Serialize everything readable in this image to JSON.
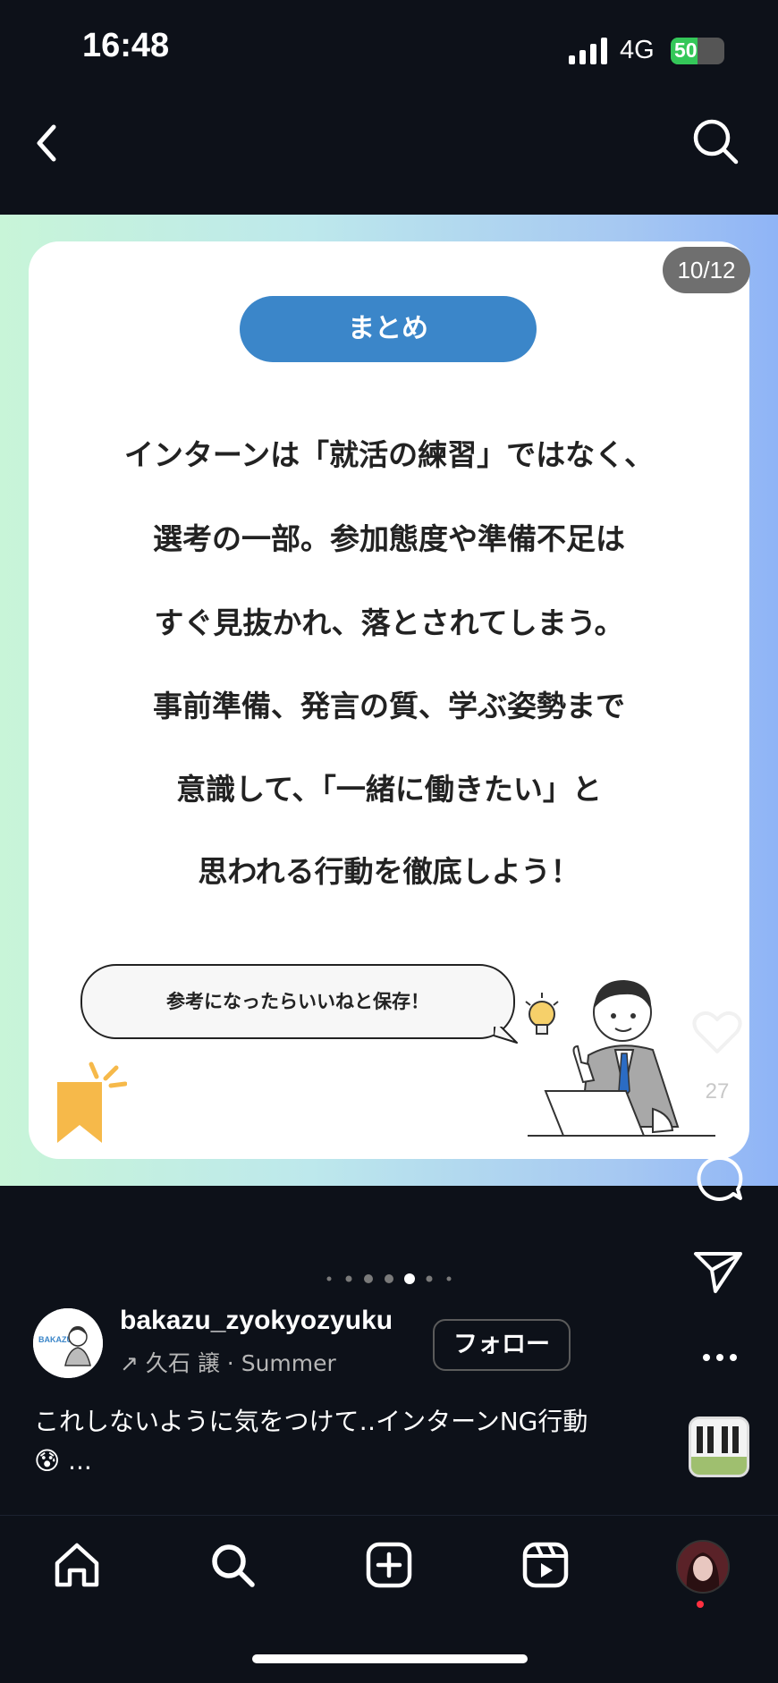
{
  "status_bar": {
    "time": "16:48",
    "network": "4G",
    "battery": "50",
    "battery_level": 0.5
  },
  "post": {
    "counter": "10/12",
    "title_pill": "まとめ",
    "body_lines": [
      "インターンは「就活の練習」ではなく、",
      "選考の一部。参加態度や準備不足は",
      "すぐ見抜かれ、落とされてしまう。",
      "事前準備、発言の質、学ぶ姿勢まで",
      "意識して、「一緒に働きたい」と",
      "思われる行動を徹底しよう！"
    ],
    "bubble_text": "参考になったらいいねと保存！",
    "avatar_brand": "BAKAZU"
  },
  "actions": {
    "like_count": "27"
  },
  "carousel": {
    "total_dots": 7,
    "active_dot": 4
  },
  "author": {
    "username": "bakazu_zyokyozyuku",
    "subline": "久石 譲 · Summer",
    "follow_label": "フォロー"
  },
  "caption": {
    "line1": "これしないように気をつけて‥インターンNG行動",
    "line2": "😰 ..."
  },
  "nav": {
    "items": [
      "home-icon",
      "search-icon",
      "create-icon",
      "reels-icon",
      "profile-avatar"
    ]
  },
  "colors": {
    "accent_pill": "#3b86c9",
    "bookmark": "#f6b94a",
    "notification_dot": "#ff3040"
  }
}
